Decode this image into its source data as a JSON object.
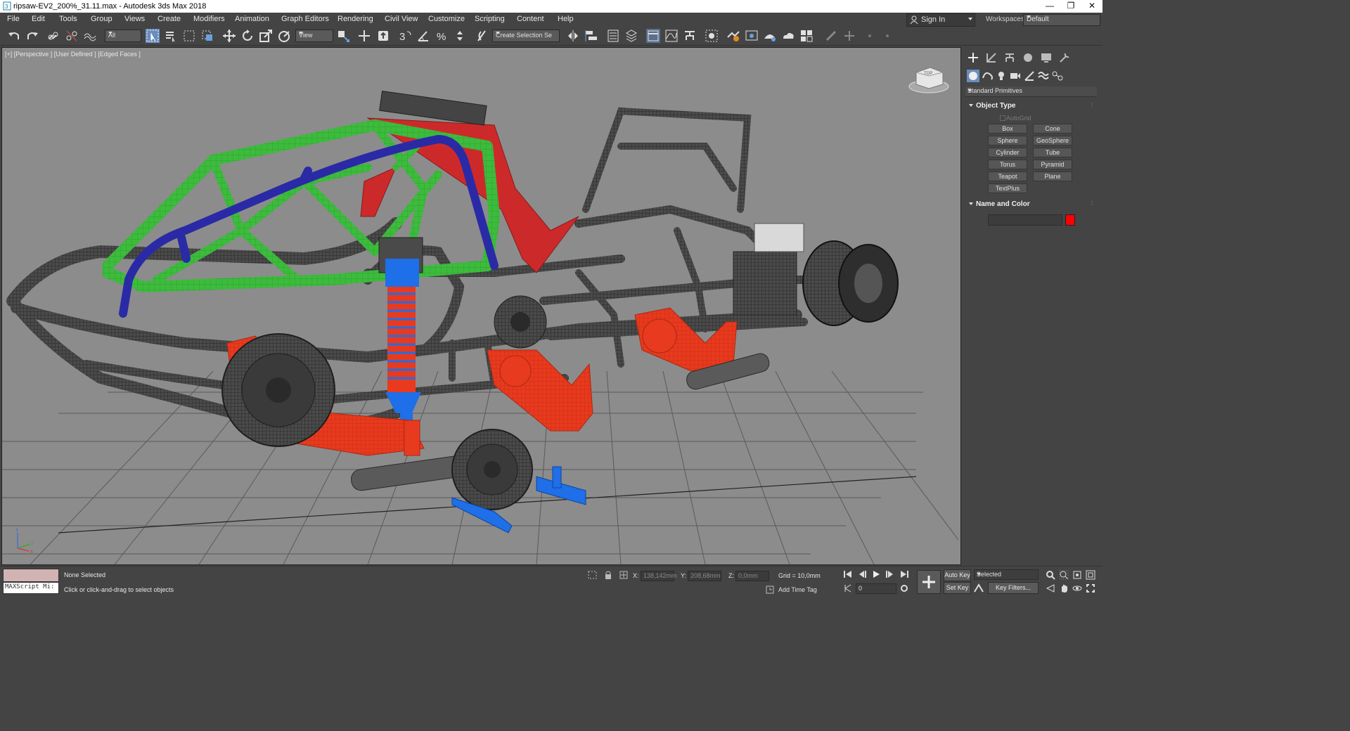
{
  "window": {
    "title": "ripsaw-EV2_200%_31.11.max - Autodesk 3ds Max 2018",
    "minimize": "—",
    "restore": "❐",
    "close": "✕"
  },
  "menu": [
    "File",
    "Edit",
    "Tools",
    "Group",
    "Views",
    "Create",
    "Modifiers",
    "Animation",
    "Graph Editors",
    "Rendering",
    "Civil View",
    "Customize",
    "Scripting",
    "Content",
    "Help"
  ],
  "account": {
    "sign_in": "Sign In",
    "workspaces_label": "Workspaces:",
    "workspace": "Default"
  },
  "toolbar": {
    "selection_filter": "All",
    "reference_coord": "View",
    "named_selection": "Create Selection Se"
  },
  "viewport": {
    "label": "[+] [Perspective ] [User Defined ] [Edged Faces ]",
    "viewcube_face": "TOP",
    "axis_z": "z",
    "axis_x": "x",
    "axis_y": "y"
  },
  "command_panel": {
    "category": "Standard Primitives",
    "object_type_title": "Object Type",
    "autogrid": "AutoGrid",
    "primitives": [
      "Box",
      "Cone",
      "Sphere",
      "GeoSphere",
      "Cylinder",
      "Tube",
      "Torus",
      "Pyramid",
      "Teapot",
      "Plane",
      "TextPlus"
    ],
    "name_color_title": "Name and Color",
    "object_name": "",
    "object_color": "#ff0000"
  },
  "status": {
    "maxscript": "MAXScript Mi:",
    "selection": "None Selected",
    "prompt": "Click or click-and-drag to select objects",
    "x_label": "X:",
    "x_value": "138,142mm",
    "y_label": "Y:",
    "y_value": "208,68mm",
    "z_label": "Z:",
    "z_value": "0,0mm",
    "grid": "Grid = 10,0mm",
    "add_time_tag": "Add Time Tag",
    "auto_key": "Auto Key",
    "set_key": "Set Key",
    "key_mode": "Selected",
    "key_filters": "Key Filters...",
    "frame": "0"
  },
  "colors": {
    "viewport_bg": "#8c8c8c",
    "ui_bg": "#444444",
    "frame_green": "#3dbb3d",
    "rollbar_blue": "#2a2aa6",
    "accent_red": "#e83a1e",
    "shock_blue": "#1e6fe8",
    "frame_gray": "#3a3a3a"
  }
}
